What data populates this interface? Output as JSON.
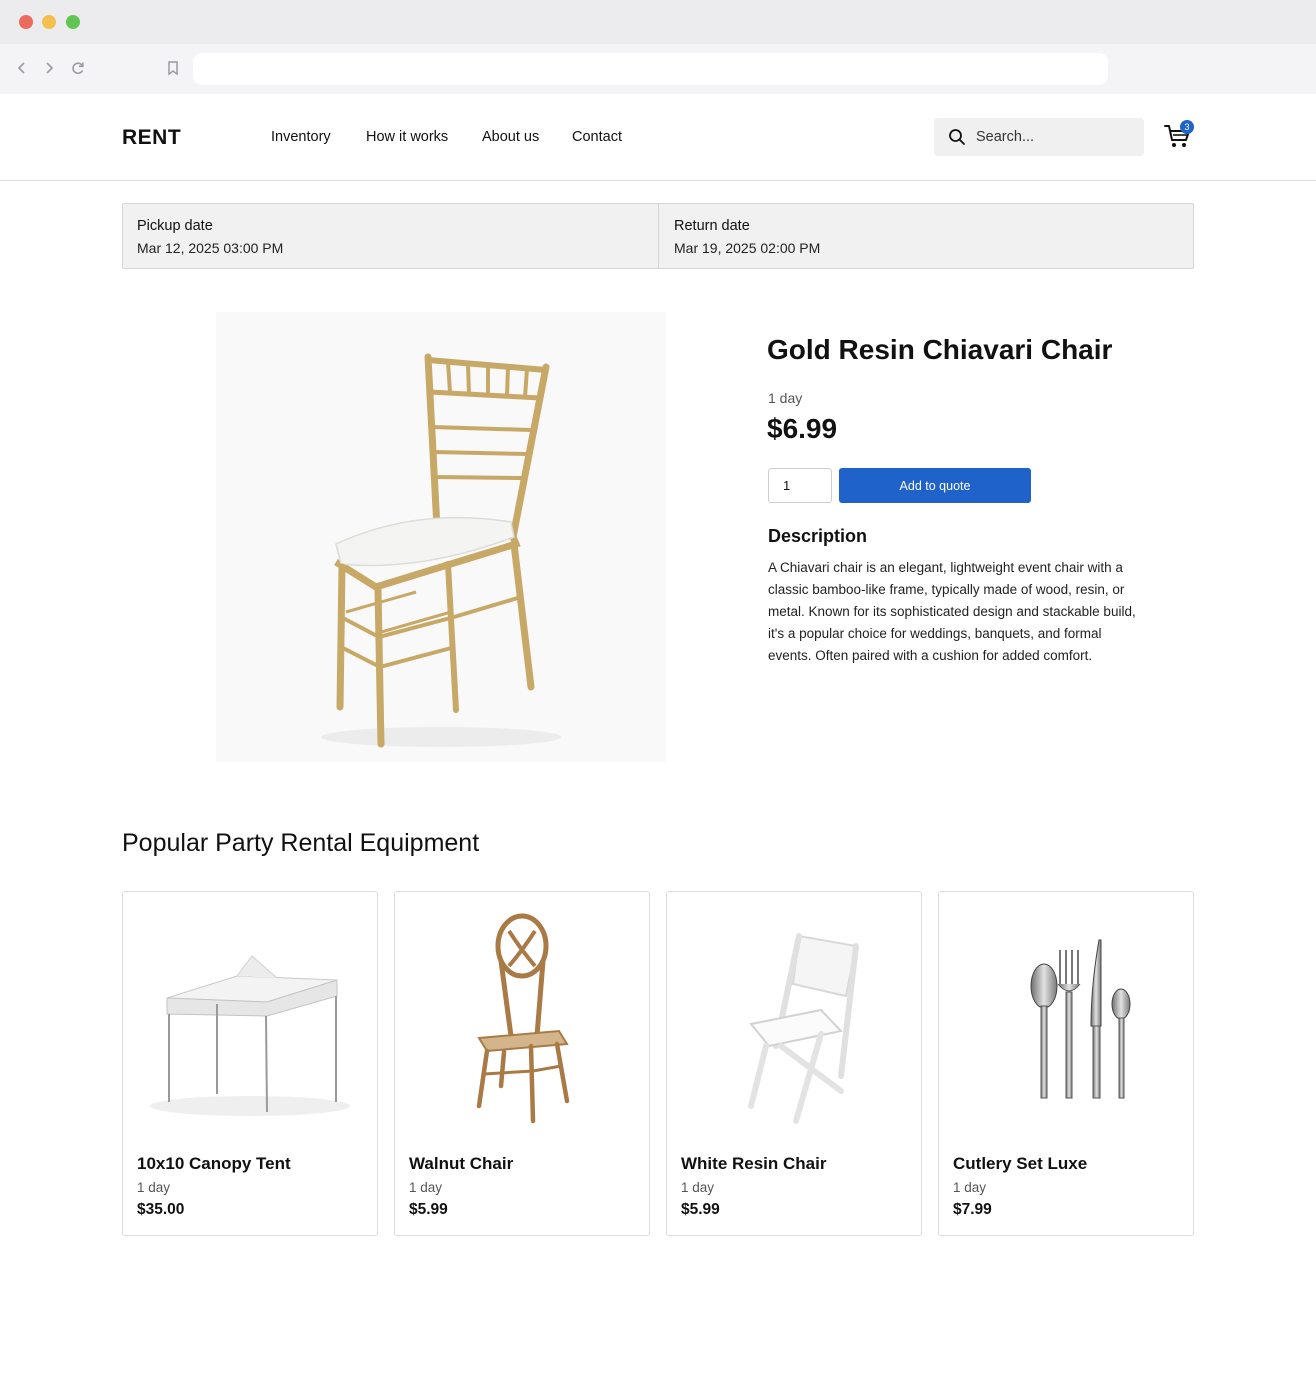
{
  "site": {
    "logo": "RENT",
    "nav": [
      "Inventory",
      "How it works",
      "About us",
      "Contact"
    ],
    "search_placeholder": "Search...",
    "cart_count": "3"
  },
  "rental_dates": {
    "pickup_label": "Pickup date",
    "pickup_value": "Mar 12, 2025 03:00 PM",
    "return_label": "Return date",
    "return_value": "Mar 19, 2025 02:00 PM"
  },
  "product": {
    "title": "Gold Resin Chiavari Chair",
    "period": "1 day",
    "price": "$6.99",
    "quantity": "1",
    "add_button": "Add to quote",
    "description_heading": "Description",
    "description": "A Chiavari chair is an elegant, lightweight event chair with a classic bamboo-like frame, typically made of wood, resin, or metal. Known for its sophisticated design and stackable build, it's a popular choice for weddings, banquets, and formal events. Often paired with a cushion for added comfort."
  },
  "popular": {
    "heading": "Popular Party Rental Equipment",
    "items": [
      {
        "name": "10x10 Canopy Tent",
        "period": "1 day",
        "price": "$35.00"
      },
      {
        "name": "Walnut Chair",
        "period": "1 day",
        "price": "$5.99"
      },
      {
        "name": "White Resin Chair",
        "period": "1 day",
        "price": "$5.99"
      },
      {
        "name": "Cutlery Set Luxe",
        "period": "1 day",
        "price": "$7.99"
      }
    ]
  },
  "colors": {
    "accent": "#1f62c9",
    "gold": "#c8a867",
    "walnut": "#a97a45"
  }
}
